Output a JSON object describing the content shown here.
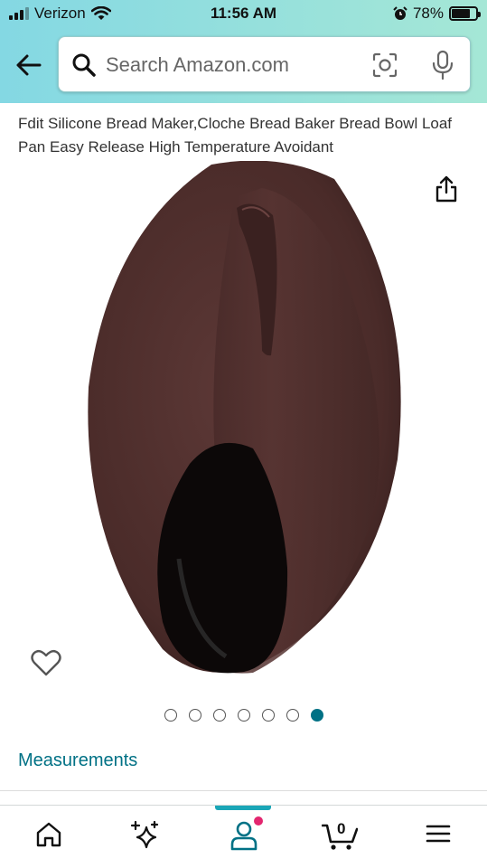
{
  "status_bar": {
    "carrier": "Verizon",
    "time": "11:56 AM",
    "battery": "78%",
    "battery_level": 0.78
  },
  "search": {
    "placeholder": "Search Amazon.com"
  },
  "product": {
    "title": "Fdit Silicone Bread Maker,Cloche Bread Baker Bread Bowl Loaf Pan Easy Release High Temperature Avoidant"
  },
  "carousel": {
    "total": 7,
    "active_index": 6
  },
  "measurements_link": "Measurements",
  "bottom_nav": {
    "cart_count": "0",
    "items": [
      "home-icon",
      "sparkle-icon",
      "account-icon",
      "cart-icon",
      "menu-icon"
    ],
    "active": "account-icon"
  },
  "colors": {
    "header_gradient_start": "#84d8e3",
    "header_gradient_end": "#a5e7d6",
    "link": "#007185",
    "active_dot": "#007185",
    "nav_active": "#1aa6b7",
    "notification": "#e3266f",
    "product_body": "#4a2b29"
  }
}
